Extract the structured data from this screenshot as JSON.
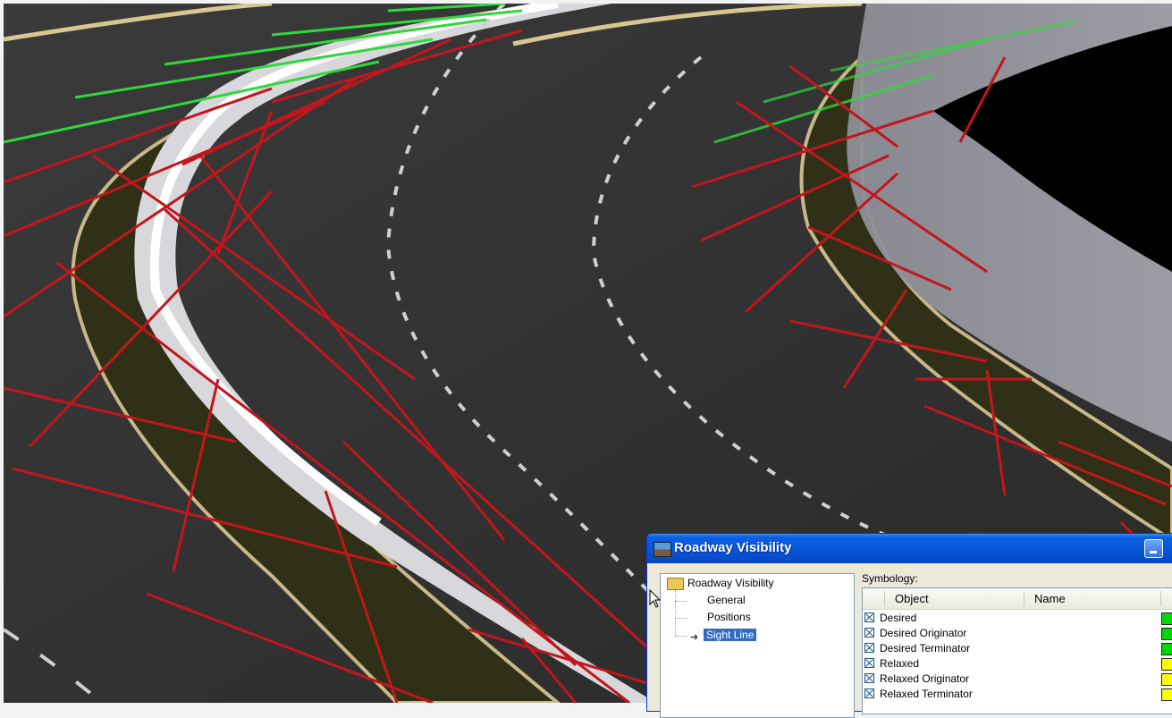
{
  "dialog": {
    "title": "Roadway Visibility",
    "tree": {
      "root": "Roadway Visibility",
      "items": [
        {
          "label": "General"
        },
        {
          "label": "Positions"
        },
        {
          "label": "Sight Line",
          "selected": true
        }
      ]
    },
    "symbology_label": "Symbology:",
    "columns": [
      "Object",
      "Name"
    ],
    "rows": [
      {
        "object": "Desired",
        "checked": true,
        "color": "#00d800"
      },
      {
        "object": "Desired Originator",
        "checked": true,
        "color": "#00d800"
      },
      {
        "object": "Desired Terminator",
        "checked": true,
        "color": "#00d800"
      },
      {
        "object": "Relaxed",
        "checked": true,
        "color": "#ffff00"
      },
      {
        "object": "Relaxed Originator",
        "checked": true,
        "color": "#ffff00"
      },
      {
        "object": "Relaxed Terminator",
        "checked": true,
        "color": "#ffff00"
      }
    ]
  },
  "scene": {
    "sight_line_colors": {
      "desired": "#2fd83a",
      "relaxed": "#c2161c"
    }
  }
}
